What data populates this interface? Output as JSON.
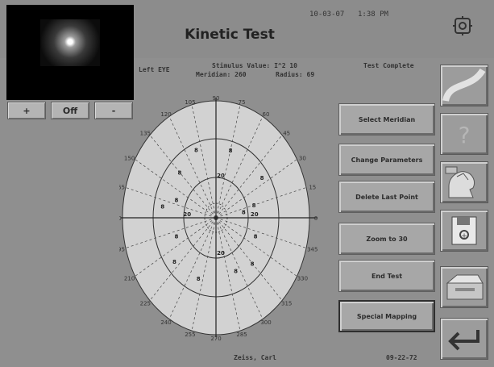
{
  "header": {
    "title": "Kinetic Test",
    "date": "10-03-07",
    "time": "1:38 PM"
  },
  "camera": {
    "plus_label": "+",
    "mode_label": "Off",
    "minus_label": "-"
  },
  "info": {
    "eye": "Left EYE",
    "stimulus": "Stimulus Value: I^2 10",
    "meridian": "Meridian:  260",
    "radius": "Radius:  69",
    "status": "Test Complete"
  },
  "actions": [
    {
      "label": "Select Meridian"
    },
    {
      "label": "Change Parameters"
    },
    {
      "label": "Delete Last Point"
    },
    {
      "label": "Zoom to 30"
    },
    {
      "label": "End Test"
    },
    {
      "label": "Special Mapping"
    }
  ],
  "side_icons": [
    {
      "name": "curve-icon"
    },
    {
      "name": "help-icon"
    },
    {
      "name": "patient-icon"
    },
    {
      "name": "save-disk-icon"
    },
    {
      "name": "printer-icon"
    },
    {
      "name": "return-icon"
    }
  ],
  "footer": {
    "patient": "Zeiss, Carl",
    "dob": "09-22-72"
  },
  "field_chart": {
    "angle_labels": [
      "105",
      "90",
      "75",
      "120",
      "60",
      "135",
      "45",
      "150",
      "30",
      "165",
      "15",
      "180",
      "0",
      "195",
      "345",
      "210",
      "330",
      "225",
      "315",
      "240",
      "300",
      "255",
      "270",
      "285"
    ],
    "isopter_points": [
      "8",
      "8",
      "8",
      "8",
      "8",
      "8",
      "8",
      "8",
      "8",
      "8",
      "8",
      "8",
      "8",
      "8"
    ],
    "ring_labels": [
      "20",
      "20",
      "20",
      "20"
    ]
  }
}
